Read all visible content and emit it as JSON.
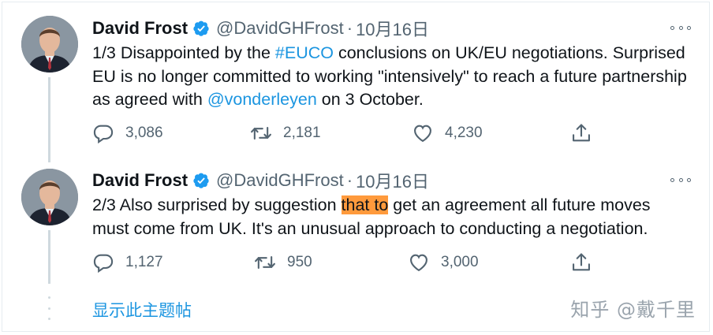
{
  "tweets": [
    {
      "author": "David Frost",
      "handle": "@DavidGHFrost",
      "separator": "·",
      "time": "10月16日",
      "text_parts": {
        "p1": "1/3 Disappointed by the ",
        "link1": "#EUCO",
        "p2": " conclusions on UK/EU negotiations. Surprised EU is no longer committed to working \"intensively\" to reach a future partnership as agreed with ",
        "link2": "@vonderleyen",
        "p3": " on 3 October."
      },
      "replies": "3,086",
      "retweets": "2,181",
      "likes": "4,230"
    },
    {
      "author": "David Frost",
      "handle": "@DavidGHFrost",
      "separator": "·",
      "time": "10月16日",
      "text_parts": {
        "p1": "2/3 Also surprised by suggestion ",
        "highlight": "that to",
        "p2": " get an agreement all future moves must come from UK. It's an unusual approach to conducting a  negotiation."
      },
      "replies": "1,127",
      "retweets": "950",
      "likes": "3,000"
    }
  ],
  "show_thread": "显示此主题帖",
  "watermark": "知乎 @戴千里",
  "icons": {
    "verified": "verified-badge-icon",
    "more": "more-options-icon",
    "reply": "reply-icon",
    "retweet": "retweet-icon",
    "like": "heart-icon",
    "share": "share-icon"
  },
  "colors": {
    "link": "#1b95e0",
    "highlight": "#ff9a3c",
    "muted": "#536471"
  }
}
